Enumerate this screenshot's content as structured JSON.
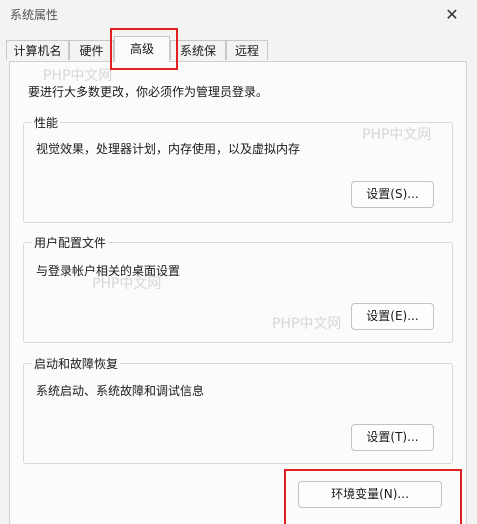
{
  "window": {
    "title": "系统属性",
    "close_icon": "close-icon"
  },
  "tabs": [
    {
      "label": "计算机名"
    },
    {
      "label": "硬件"
    },
    {
      "label": "高级"
    },
    {
      "label": "系统保护"
    },
    {
      "label": "远程"
    }
  ],
  "intro_text": "要进行大多数更改，你必须作为管理员登录。",
  "groups": {
    "performance": {
      "title": "性能",
      "description": "视觉效果，处理器计划，内存使用，以及虚拟内存",
      "button": "设置(S)..."
    },
    "user_profiles": {
      "title": "用户配置文件",
      "description": "与登录帐户相关的桌面设置",
      "button": "设置(E)..."
    },
    "startup_recovery": {
      "title": "启动和故障恢复",
      "description": "系统启动、系统故障和调试信息",
      "button": "设置(T)..."
    }
  },
  "env_button": "环境变量(N)...",
  "watermark": "PHP中文网",
  "highlight_color": "#e02020"
}
